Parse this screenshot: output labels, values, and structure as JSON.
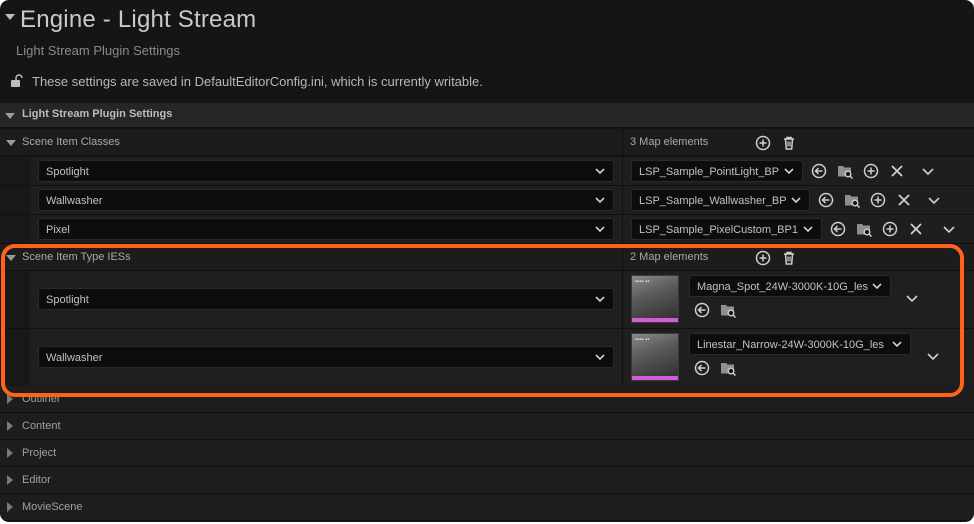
{
  "header": {
    "title": "Engine - Light Stream",
    "subtitle": "Light Stream Plugin Settings",
    "notice": "These settings are saved in DefaultEditorConfig.ini, which is currently writable."
  },
  "section": {
    "label": "Light Stream Plugin Settings"
  },
  "scene_item_classes": {
    "label": "Scene Item Classes",
    "count": "3 Map elements",
    "entries": [
      {
        "key": "Spotlight",
        "value": "LSP_Sample_PointLight_BP"
      },
      {
        "key": "Wallwasher",
        "value": "LSP_Sample_Wallwasher_BP"
      },
      {
        "key": "Pixel",
        "value": "LSP_Sample_PixelCustom_BP1"
      }
    ]
  },
  "scene_item_type_ies": {
    "label": "Scene Item Type IESs",
    "count": "2 Map elements",
    "entries": [
      {
        "key": "Spotlight",
        "value": "Magna_Spot_24W-3000K-10G_les"
      },
      {
        "key": "Wallwasher",
        "value": "Linestar_Narrow-24W-3000K-10G_les"
      }
    ]
  },
  "collapsed_sections": [
    "Outliner",
    "Content",
    "Project",
    "Editor",
    "MovieScene"
  ],
  "icons": {
    "add": "add-circle-icon",
    "delete": "trash-icon",
    "use_selected": "arrow-left-circle-icon",
    "browse": "folder-search-icon",
    "clear": "close-icon"
  },
  "colors": {
    "highlight": "#ff6319",
    "thumb_bar": "#d45ad8"
  }
}
